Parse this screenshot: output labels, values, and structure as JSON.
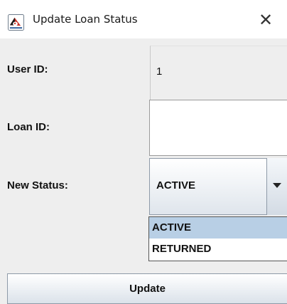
{
  "window": {
    "title": "Update Loan Status",
    "close_glyph": "✕",
    "app_icon": "java-duke-icon"
  },
  "form": {
    "user_id": {
      "label": "User ID:",
      "value": "1"
    },
    "loan_id": {
      "label": "Loan ID:",
      "value": "",
      "placeholder": ""
    },
    "new_status": {
      "label": "New Status:",
      "selected": "ACTIVE",
      "options": [
        "ACTIVE",
        "RETURNED"
      ],
      "highlighted": "ACTIVE"
    }
  },
  "actions": {
    "update_label": "Update"
  },
  "colors": {
    "content_bg": "#eeeeee",
    "highlight": "#b8cfe5",
    "border": "#8e9aa8"
  }
}
